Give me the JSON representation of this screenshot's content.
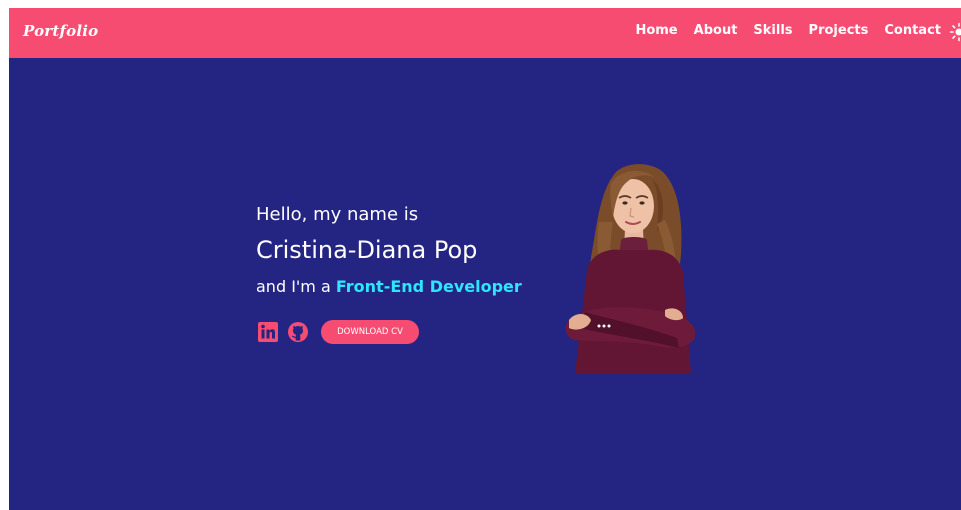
{
  "nav": {
    "brand": "Portfolio",
    "links": [
      "Home",
      "About",
      "Skills",
      "Projects",
      "Contact"
    ],
    "theme_toggle_icon": "sun-icon"
  },
  "hero": {
    "greeting": "Hello, my name is",
    "name": "Cristina-Diana Pop",
    "role_prefix": "and I'm a",
    "role": "Front-End Developer",
    "social_icons": [
      "linkedin-icon",
      "github-icon"
    ],
    "cv_button": "DOWNLOAD CV"
  },
  "colors": {
    "primary": "#f64c72",
    "background": "#242582",
    "accent": "#2ee6ff",
    "text": "#ffffff"
  }
}
